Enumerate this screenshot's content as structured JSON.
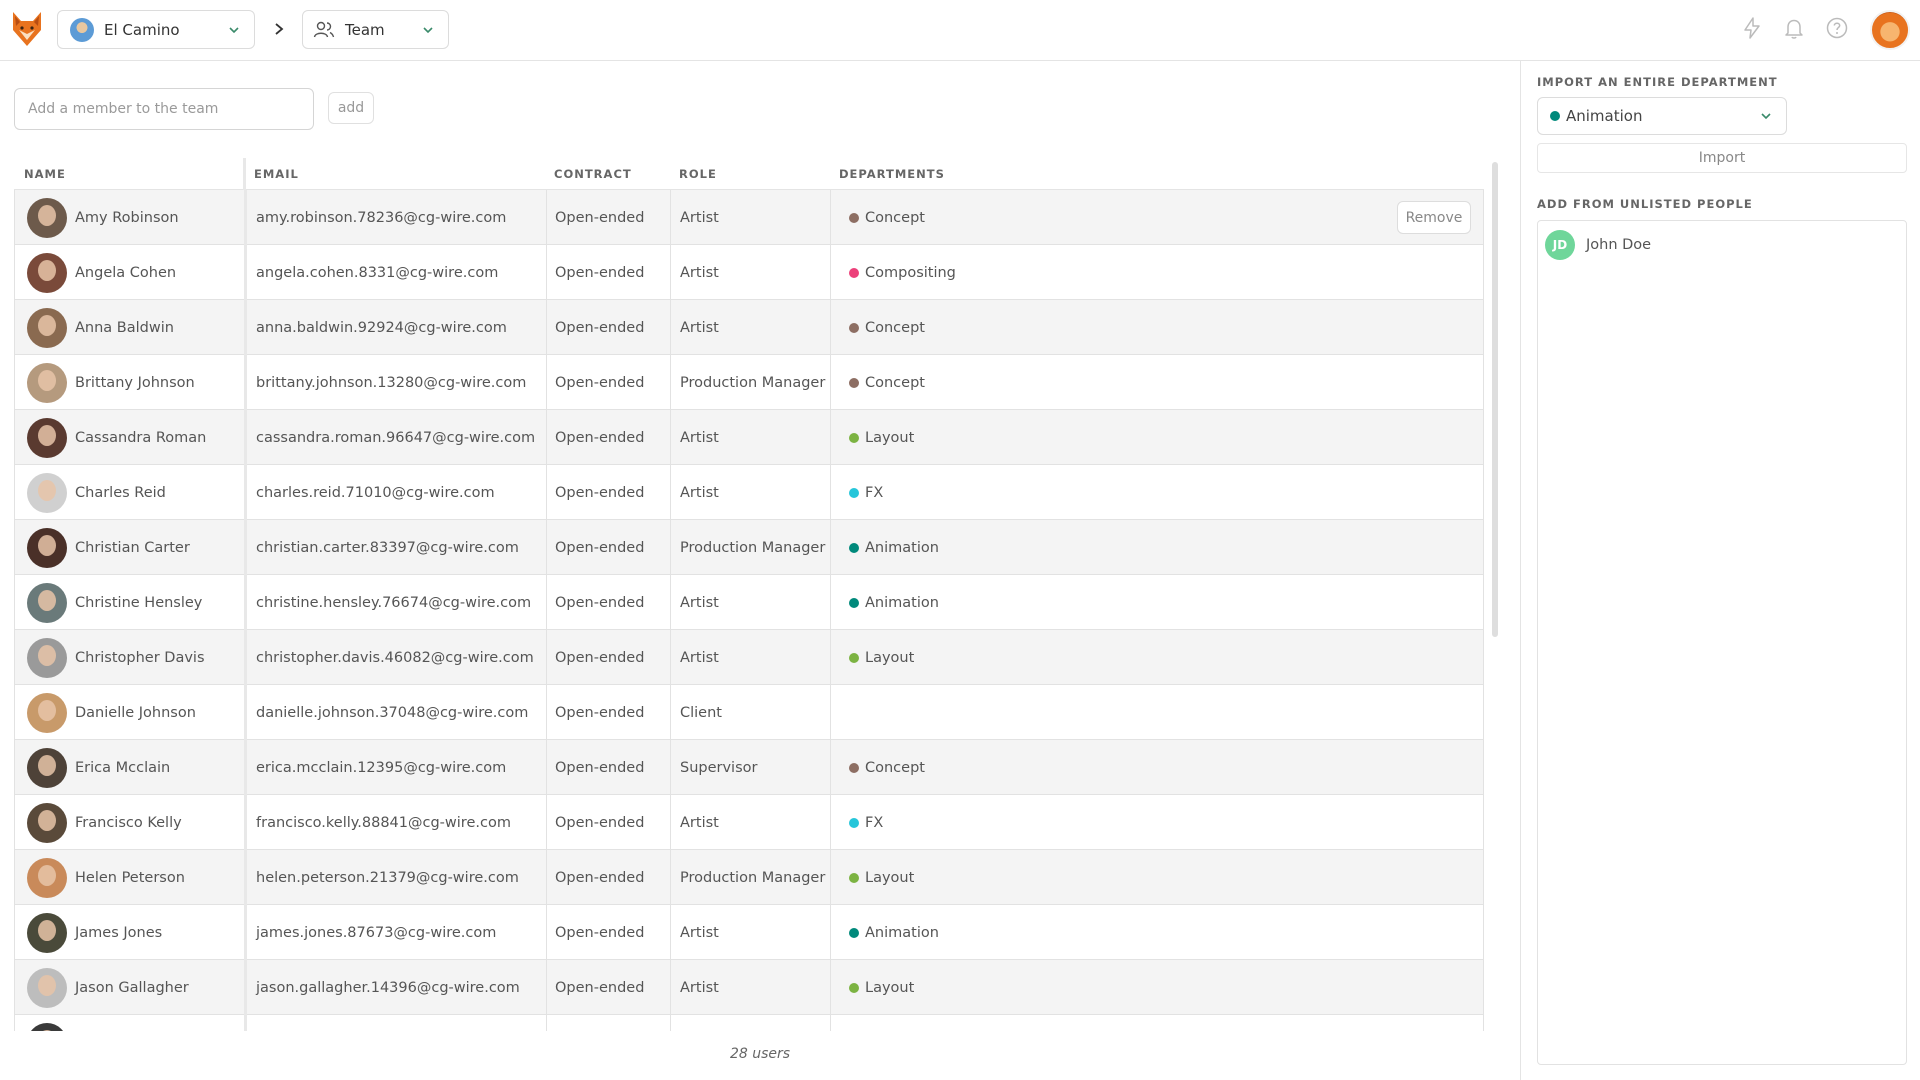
{
  "header": {
    "production": "El Camino",
    "section": "Team"
  },
  "add_member": {
    "placeholder": "Add a member to the team",
    "button": "add"
  },
  "table": {
    "columns": [
      "NAME",
      "EMAIL",
      "CONTRACT",
      "ROLE",
      "DEPARTMENTS"
    ],
    "remove_label": "Remove",
    "rows": [
      {
        "name": "Amy Robinson",
        "email": "amy.robinson.78236@cg-wire.com",
        "contract": "Open-ended",
        "role": "Artist",
        "department": "Concept",
        "dept_color": "#8d6e63",
        "avatar": "#6d5a4b"
      },
      {
        "name": "Angela Cohen",
        "email": "angela.cohen.8331@cg-wire.com",
        "contract": "Open-ended",
        "role": "Artist",
        "department": "Compositing",
        "dept_color": "#ec407a",
        "avatar": "#7a4a3a"
      },
      {
        "name": "Anna Baldwin",
        "email": "anna.baldwin.92924@cg-wire.com",
        "contract": "Open-ended",
        "role": "Artist",
        "department": "Concept",
        "dept_color": "#8d6e63",
        "avatar": "#8a6a50"
      },
      {
        "name": "Brittany Johnson",
        "email": "brittany.johnson.13280@cg-wire.com",
        "contract": "Open-ended",
        "role": "Production Manager",
        "department": "Concept",
        "dept_color": "#8d6e63",
        "avatar": "#b59a7e"
      },
      {
        "name": "Cassandra Roman",
        "email": "cassandra.roman.96647@cg-wire.com",
        "contract": "Open-ended",
        "role": "Artist",
        "department": "Layout",
        "dept_color": "#7cb342",
        "avatar": "#5a3a30"
      },
      {
        "name": "Charles Reid",
        "email": "charles.reid.71010@cg-wire.com",
        "contract": "Open-ended",
        "role": "Artist",
        "department": "FX",
        "dept_color": "#26c6da",
        "avatar": "#d0d0d0"
      },
      {
        "name": "Christian Carter",
        "email": "christian.carter.83397@cg-wire.com",
        "contract": "Open-ended",
        "role": "Production Manager",
        "department": "Animation",
        "dept_color": "#00897b",
        "avatar": "#4a3028"
      },
      {
        "name": "Christine Hensley",
        "email": "christine.hensley.76674@cg-wire.com",
        "contract": "Open-ended",
        "role": "Artist",
        "department": "Animation",
        "dept_color": "#00897b",
        "avatar": "#6a7a7a"
      },
      {
        "name": "Christopher Davis",
        "email": "christopher.davis.46082@cg-wire.com",
        "contract": "Open-ended",
        "role": "Artist",
        "department": "Layout",
        "dept_color": "#7cb342",
        "avatar": "#9a9a9a"
      },
      {
        "name": "Danielle Johnson",
        "email": "danielle.johnson.37048@cg-wire.com",
        "contract": "Open-ended",
        "role": "Client",
        "department": "",
        "dept_color": "",
        "avatar": "#c89a6a"
      },
      {
        "name": "Erica Mcclain",
        "email": "erica.mcclain.12395@cg-wire.com",
        "contract": "Open-ended",
        "role": "Supervisor",
        "department": "Concept",
        "dept_color": "#8d6e63",
        "avatar": "#4e4238"
      },
      {
        "name": "Francisco Kelly",
        "email": "francisco.kelly.88841@cg-wire.com",
        "contract": "Open-ended",
        "role": "Artist",
        "department": "FX",
        "dept_color": "#26c6da",
        "avatar": "#5a4a3a"
      },
      {
        "name": "Helen Peterson",
        "email": "helen.peterson.21379@cg-wire.com",
        "contract": "Open-ended",
        "role": "Production Manager",
        "department": "Layout",
        "dept_color": "#7cb342",
        "avatar": "#c98a5a"
      },
      {
        "name": "James Jones",
        "email": "james.jones.87673@cg-wire.com",
        "contract": "Open-ended",
        "role": "Artist",
        "department": "Animation",
        "dept_color": "#00897b",
        "avatar": "#4a4a3a"
      },
      {
        "name": "Jason Gallagher",
        "email": "jason.gallagher.14396@cg-wire.com",
        "contract": "Open-ended",
        "role": "Artist",
        "department": "Layout",
        "dept_color": "#7cb342",
        "avatar": "#bdbdbd"
      },
      {
        "name": "",
        "email": "",
        "contract": "",
        "role": "",
        "department": "",
        "dept_color": "",
        "avatar": "#3a3a3a"
      }
    ]
  },
  "footer": {
    "count": "28 users"
  },
  "side_panel": {
    "import_heading": "IMPORT AN ENTIRE DEPARTMENT",
    "selected_department": "Animation",
    "selected_department_color": "#00897b",
    "import_button": "Import",
    "unlisted_heading": "ADD FROM UNLISTED PEOPLE",
    "unlisted": [
      {
        "initials": "JD",
        "name": "John Doe"
      }
    ]
  },
  "icons": [
    "kitsu-logo-icon",
    "chevron-down-icon",
    "chevron-right-icon",
    "team-icon",
    "lightning-icon",
    "bell-icon",
    "help-icon"
  ]
}
